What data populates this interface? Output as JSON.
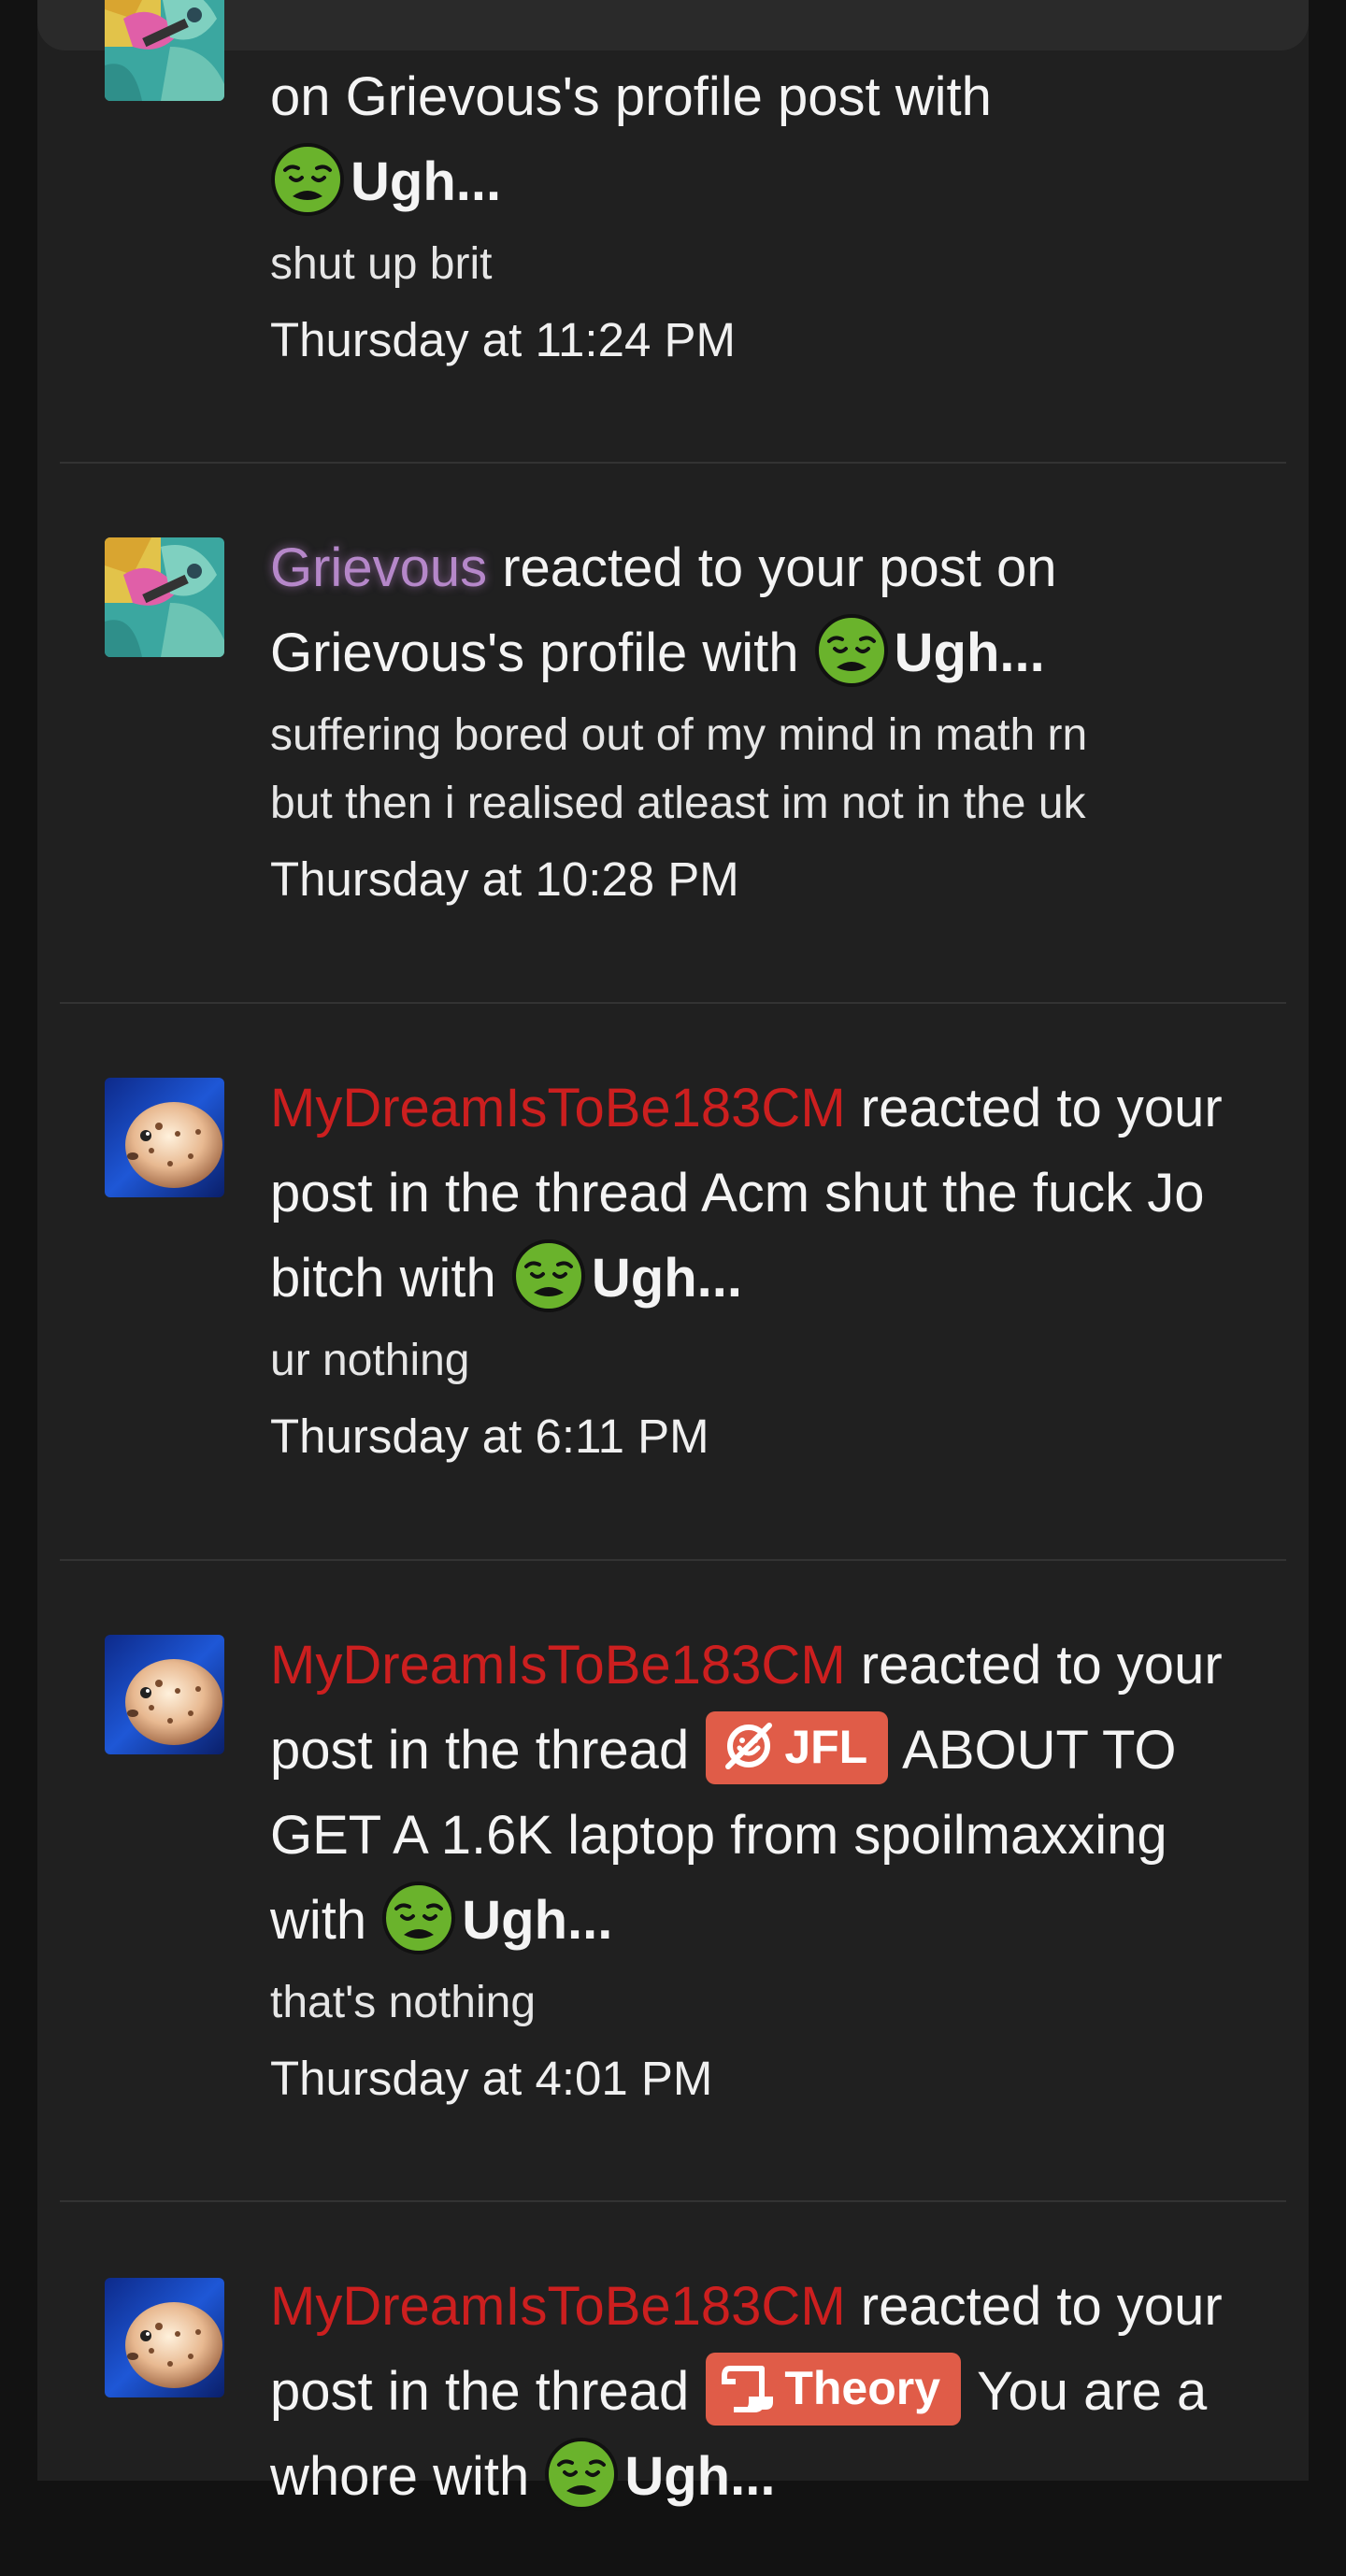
{
  "notifications": [
    {
      "user": "",
      "action": "on Grievous's profile post with ",
      "reaction": "Ugh...",
      "snippet": "shut up brit",
      "time": "Thursday at 11:24 PM",
      "avatar": "jojo-avatar"
    },
    {
      "user": "Grievous",
      "action": " reacted to your post on Grievous's profile with ",
      "reaction": "Ugh...",
      "snippet_line1": "suffering bored out of my mind in math rn",
      "snippet_line2": "but then i realised atleast im not in the uk",
      "time": "Thursday at 10:28 PM",
      "avatar": "jojo-avatar"
    },
    {
      "user": "MyDreamIsToBe183CM",
      "action": " reacted to your post in the thread Acm shut the fuck Jo bitch with ",
      "reaction": "Ugh...",
      "snippet": "ur nothing",
      "time": "Thursday at 6:11 PM",
      "avatar": "pufferfish-avatar"
    },
    {
      "user": "MyDreamIsToBe183CM",
      "action_before": " reacted to your post in the thread ",
      "prefix": "JFL",
      "prefix_icon": "laugh-icon",
      "action_after": " ABOUT TO GET A 1.6K laptop from spoilmaxxing with ",
      "reaction": "Ugh...",
      "snippet": "that's nothing",
      "time": "Thursday at 4:01 PM",
      "avatar": "pufferfish-avatar"
    },
    {
      "user": "MyDreamIsToBe183CM",
      "action_before": " reacted to your post in the thread ",
      "prefix": "Theory",
      "prefix_icon": "scroll-icon",
      "action_after": " You are a whore with ",
      "reaction": "Ugh...",
      "avatar": "pufferfish-avatar"
    }
  ],
  "colors": {
    "background": "#202020",
    "user_purple": "#b587c9",
    "user_red": "#cc1f1f",
    "prefix_bg": "#e05c48"
  }
}
